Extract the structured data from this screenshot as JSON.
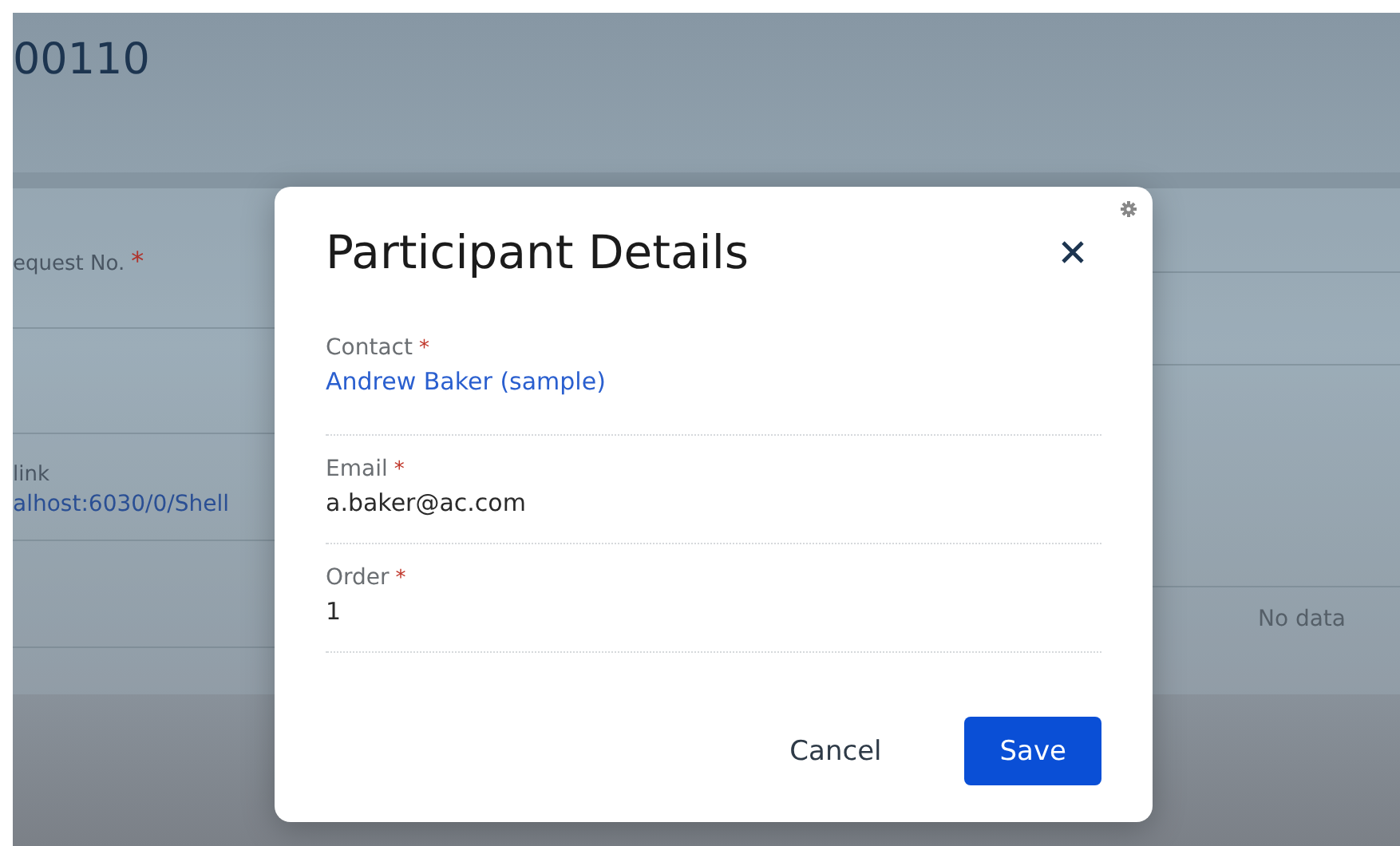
{
  "page": {
    "title": "00110",
    "fields": [
      {
        "label": "equest No.",
        "required_mark": "*"
      },
      {
        "label": "link",
        "value": "alhost:6030/0/Shell"
      }
    ],
    "empty_text": "No data"
  },
  "dialog": {
    "title": "Participant Details",
    "fields": [
      {
        "label": "Contact",
        "required_mark": "*",
        "kind": "link",
        "value": "Andrew Baker (sample)"
      },
      {
        "label": "Email",
        "required_mark": "*",
        "kind": "text",
        "value": "a.baker@ac.com"
      },
      {
        "label": "Order",
        "required_mark": "*",
        "kind": "text",
        "value": "1"
      }
    ],
    "buttons": [
      {
        "label": "Cancel",
        "kind": "secondary"
      },
      {
        "label": "Save",
        "kind": "primary"
      }
    ]
  }
}
